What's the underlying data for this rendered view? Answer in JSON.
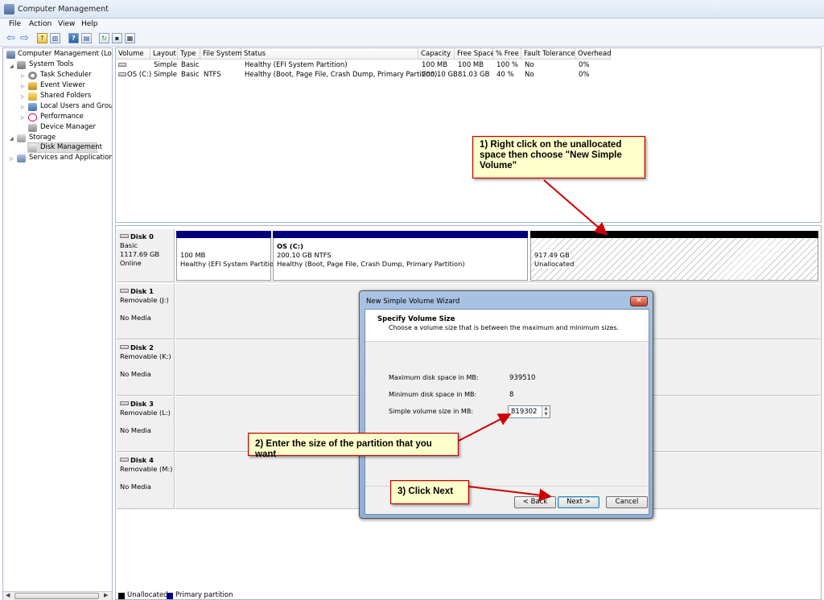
{
  "window": {
    "title": "Computer Management"
  },
  "menu": [
    "File",
    "Action",
    "View",
    "Help"
  ],
  "toolbar": {
    "back_icon": "back-arrow-icon",
    "forward_icon": "forward-arrow-icon",
    "up_icon": "up-folder-icon",
    "show_hide_icon": "show-hide-tree-icon",
    "help_icon": "help-icon",
    "console_icon": "console-view-icon",
    "refresh_icon": "refresh-icon",
    "properties_icon": "properties-icon",
    "export_icon": "export-list-icon"
  },
  "tree": [
    {
      "label": "Computer Management (Local",
      "level": 0,
      "expander": "",
      "icon": "computer-icon"
    },
    {
      "label": "System Tools",
      "level": 1,
      "expander": "◢",
      "icon": "tools-icon"
    },
    {
      "label": "Task Scheduler",
      "level": 2,
      "expander": "▷",
      "icon": "clock-icon"
    },
    {
      "label": "Event Viewer",
      "level": 2,
      "expander": "▷",
      "icon": "event-viewer-icon"
    },
    {
      "label": "Shared Folders",
      "level": 2,
      "expander": "▷",
      "icon": "shared-folder-icon"
    },
    {
      "label": "Local Users and Groups",
      "level": 2,
      "expander": "▷",
      "icon": "users-icon"
    },
    {
      "label": "Performance",
      "level": 2,
      "expander": "▷",
      "icon": "performance-icon"
    },
    {
      "label": "Device Manager",
      "level": 2,
      "expander": "",
      "icon": "device-manager-icon"
    },
    {
      "label": "Storage",
      "level": 1,
      "expander": "◢",
      "icon": "storage-icon"
    },
    {
      "label": "Disk Management",
      "level": 2,
      "expander": "",
      "icon": "disk-management-icon",
      "selected": true
    },
    {
      "label": "Services and Applications",
      "level": 1,
      "expander": "▷",
      "icon": "services-icon"
    }
  ],
  "volume_table": {
    "columns": [
      "Volume",
      "Layout",
      "Type",
      "File System",
      "Status",
      "Capacity",
      "Free Space",
      "% Free",
      "Fault Tolerance",
      "Overhead"
    ],
    "rows": [
      [
        "",
        "Simple",
        "Basic",
        "",
        "Healthy (EFI System Partition)",
        "100 MB",
        "100 MB",
        "100 %",
        "No",
        "0%"
      ],
      [
        "OS (C:)",
        "Simple",
        "Basic",
        "NTFS",
        "Healthy (Boot, Page File, Crash Dump, Primary Partition)",
        "200.10 GB",
        "81.03 GB",
        "40 %",
        "No",
        "0%"
      ]
    ]
  },
  "disks": [
    {
      "name": "Disk 0",
      "line1": "Basic",
      "line2": "1117.69 GB",
      "line3": "Online"
    },
    {
      "name": "Disk 1",
      "line1": "Removable (J:)",
      "line2": "",
      "line3": "No Media"
    },
    {
      "name": "Disk 2",
      "line1": "Removable (K:)",
      "line2": "",
      "line3": "No Media"
    },
    {
      "name": "Disk 3",
      "line1": "Removable (L:)",
      "line2": "",
      "line3": "No Media"
    },
    {
      "name": "Disk 4",
      "line1": "Removable (M:)",
      "line2": "",
      "line3": "No Media"
    }
  ],
  "partitions": [
    {
      "title": "",
      "size": "100 MB",
      "status": "Healthy (EFI System Partition"
    },
    {
      "title": "OS  (C:)",
      "size": "200.10 GB NTFS",
      "status": "Healthy (Boot, Page File, Crash Dump, Primary Partition)"
    },
    {
      "title": "",
      "size": "917.49 GB",
      "status": "Unallocated"
    }
  ],
  "legend": {
    "unallocated": "Unallocated",
    "primary": "Primary partition"
  },
  "colors": {
    "primary": "#00007f",
    "unallocated": "#000000",
    "callout_border": "#b00000",
    "arrow": "#cc0000"
  },
  "callouts": {
    "c1": "1) Right click on the unallocated space then choose \"New Simple Volume\"",
    "c2": "2) Enter the size of the partition that you want",
    "c3": "3) Click Next"
  },
  "dialog": {
    "title": "New Simple Volume Wizard",
    "heading": "Specify Volume Size",
    "subheading": "Choose a volume size that is between the maximum and minimum sizes.",
    "max_label": "Maximum disk space in MB:",
    "max_value": "939510",
    "min_label": "Minimum disk space in MB:",
    "min_value": "8",
    "size_label": "Simple volume size in MB:",
    "size_value": "819302",
    "back": "< Back",
    "next": "Next >",
    "cancel": "Cancel"
  }
}
